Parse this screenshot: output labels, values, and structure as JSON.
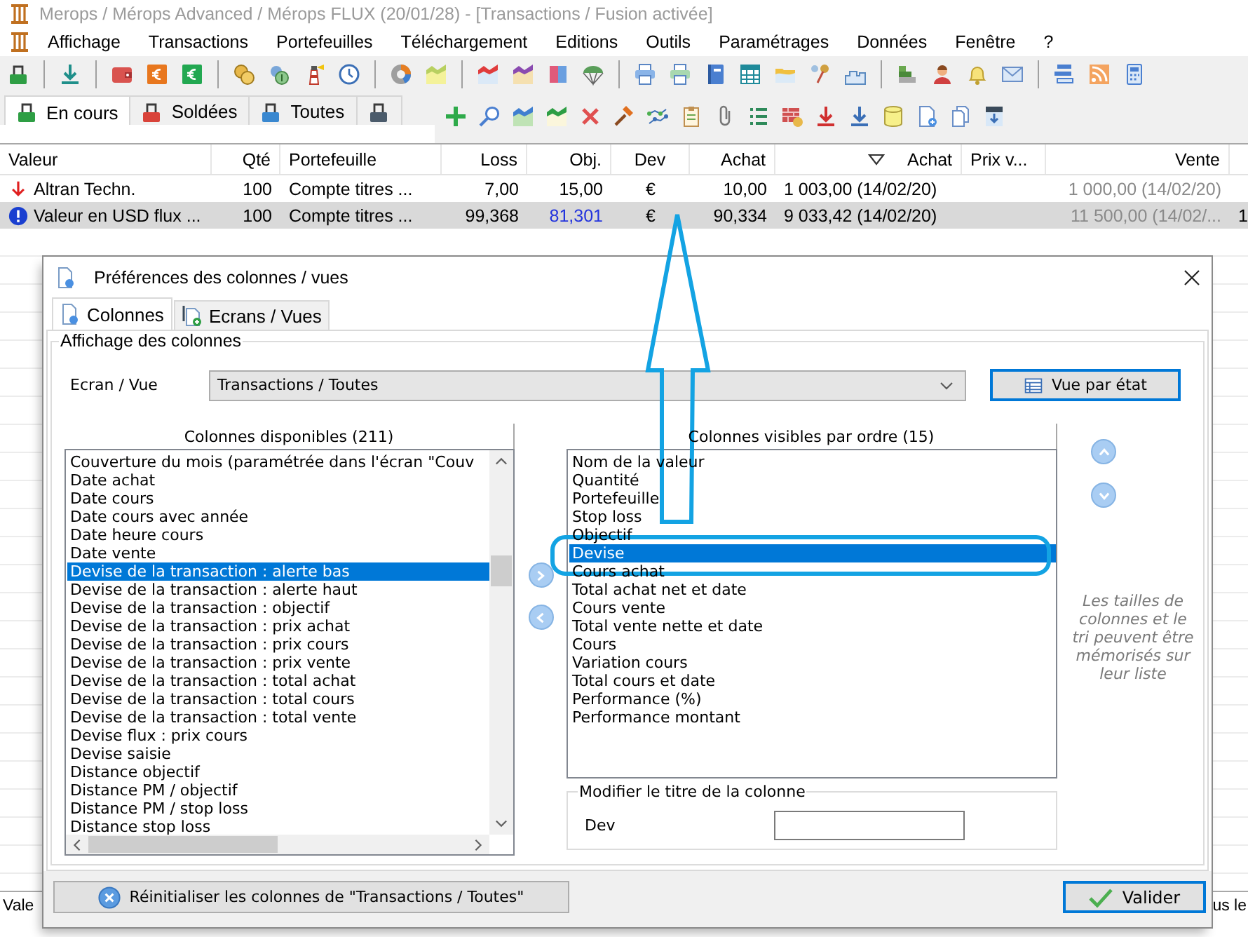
{
  "window": {
    "title": "Merops / Mérops Advanced / Mérops FLUX (20/01/28) - [Transactions / Fusion activée]"
  },
  "menu": [
    "Affichage",
    "Transactions",
    "Portefeuilles",
    "Téléchargement",
    "Editions",
    "Outils",
    "Paramétrages",
    "Données",
    "Fenêtre",
    "?"
  ],
  "tabs": [
    {
      "label": "En cours",
      "selected": true,
      "color": "#2e9e44"
    },
    {
      "label": "Soldées",
      "selected": false,
      "color": "#d9433a"
    },
    {
      "label": "Toutes",
      "selected": false,
      "color": "#3a88d0"
    },
    {
      "selected": false,
      "color": "#4b5b6b"
    }
  ],
  "table": {
    "columns": [
      {
        "label": "Valeur",
        "sorted": false
      },
      {
        "label": "Qté",
        "sorted": false
      },
      {
        "label": "Portefeuille",
        "sorted": false
      },
      {
        "label": "Loss",
        "sorted": false
      },
      {
        "label": "Obj.",
        "sorted": false
      },
      {
        "label": "Dev",
        "sorted": false
      },
      {
        "label": "Achat",
        "sorted": false
      },
      {
        "label": "Achat",
        "sorted": true
      },
      {
        "label": "Prix v...",
        "sorted": false
      },
      {
        "label": "Vente",
        "sorted": false
      }
    ],
    "rows": [
      {
        "kind": "down",
        "selected": false,
        "obj_highlighted": false,
        "cells": [
          "Altran Techn.",
          "100",
          "Compte titres ...",
          "7,00",
          "15,00",
          "€",
          "10,00",
          "1 003,00 (14/02/20)",
          null,
          "1 000,00 (14/02/20)",
          null
        ]
      },
      {
        "kind": "alert",
        "selected": true,
        "obj_highlighted": true,
        "cells": [
          "Valeur en USD flux ...",
          "100",
          "Compte titres ...",
          "99,368",
          "81,301",
          "€",
          "90,334",
          "9 033,42 (14/02/20)",
          null,
          "11 500,00 (14/02/...",
          "1"
        ]
      }
    ]
  },
  "dialog": {
    "title": "Préférences des colonnes / vues",
    "tabs": [
      {
        "label": "Colonnes",
        "selected": true
      },
      {
        "label": "Ecrans / Vues",
        "selected": false
      }
    ],
    "group_title": "Affichage des colonnes",
    "screen": {
      "label": "Ecran / Vue",
      "value": "Transactions / Toutes"
    },
    "state_view_button": "Vue par état",
    "available": {
      "title": "Colonnes disponibles (211)",
      "items": [
        {
          "label": "Couverture du mois (paramétrée dans l'écran \"Couv",
          "selected": false
        },
        {
          "label": "Date achat",
          "selected": false
        },
        {
          "label": "Date cours",
          "selected": false
        },
        {
          "label": "Date cours avec année",
          "selected": false
        },
        {
          "label": "Date heure cours",
          "selected": false
        },
        {
          "label": "Date vente",
          "selected": false
        },
        {
          "label": "Devise de la transaction : alerte bas",
          "selected": true
        },
        {
          "label": "Devise de la transaction : alerte haut",
          "selected": false
        },
        {
          "label": "Devise de la transaction : objectif",
          "selected": false
        },
        {
          "label": "Devise de la transaction : prix achat",
          "selected": false
        },
        {
          "label": "Devise de la transaction : prix cours",
          "selected": false
        },
        {
          "label": "Devise de la transaction : prix vente",
          "selected": false
        },
        {
          "label": "Devise de la transaction : total achat",
          "selected": false
        },
        {
          "label": "Devise de la transaction : total cours",
          "selected": false
        },
        {
          "label": "Devise de la transaction : total vente",
          "selected": false
        },
        {
          "label": "Devise flux : prix cours",
          "selected": false
        },
        {
          "label": "Devise saisie",
          "selected": false
        },
        {
          "label": "Distance objectif",
          "selected": false
        },
        {
          "label": "Distance PM / objectif",
          "selected": false
        },
        {
          "label": "Distance PM / stop loss",
          "selected": false
        },
        {
          "label": "Distance stop loss",
          "selected": false
        }
      ]
    },
    "visible": {
      "title": "Colonnes visibles par ordre (15)",
      "items": [
        {
          "label": "Nom de la valeur",
          "selected": false
        },
        {
          "label": "Quantité",
          "selected": false
        },
        {
          "label": "Portefeuille",
          "selected": false
        },
        {
          "label": "Stop loss",
          "selected": false
        },
        {
          "label": "Objectif",
          "selected": false
        },
        {
          "label": "Devise",
          "selected": true
        },
        {
          "label": "Cours achat",
          "selected": false
        },
        {
          "label": "Total achat net et date",
          "selected": false
        },
        {
          "label": "Cours vente",
          "selected": false
        },
        {
          "label": "Total vente nette et date",
          "selected": false
        },
        {
          "label": "Cours",
          "selected": false
        },
        {
          "label": "Variation cours",
          "selected": false
        },
        {
          "label": "Total cours et date",
          "selected": false
        },
        {
          "label": "Performance (%)",
          "selected": false
        },
        {
          "label": "Performance montant",
          "selected": false
        }
      ]
    },
    "rename": {
      "title": "Modifier le titre de la colonne",
      "label": "Dev"
    },
    "note": "Les tailles de colonnes et le tri peuvent être mémorisés sur leur liste",
    "reset_button": "Réinitialiser les colonnes de \"Transactions / Toutes\"",
    "ok_button": "Valider"
  },
  "lower_table": {
    "columns": [
      "Vale",
      "us le"
    ]
  }
}
